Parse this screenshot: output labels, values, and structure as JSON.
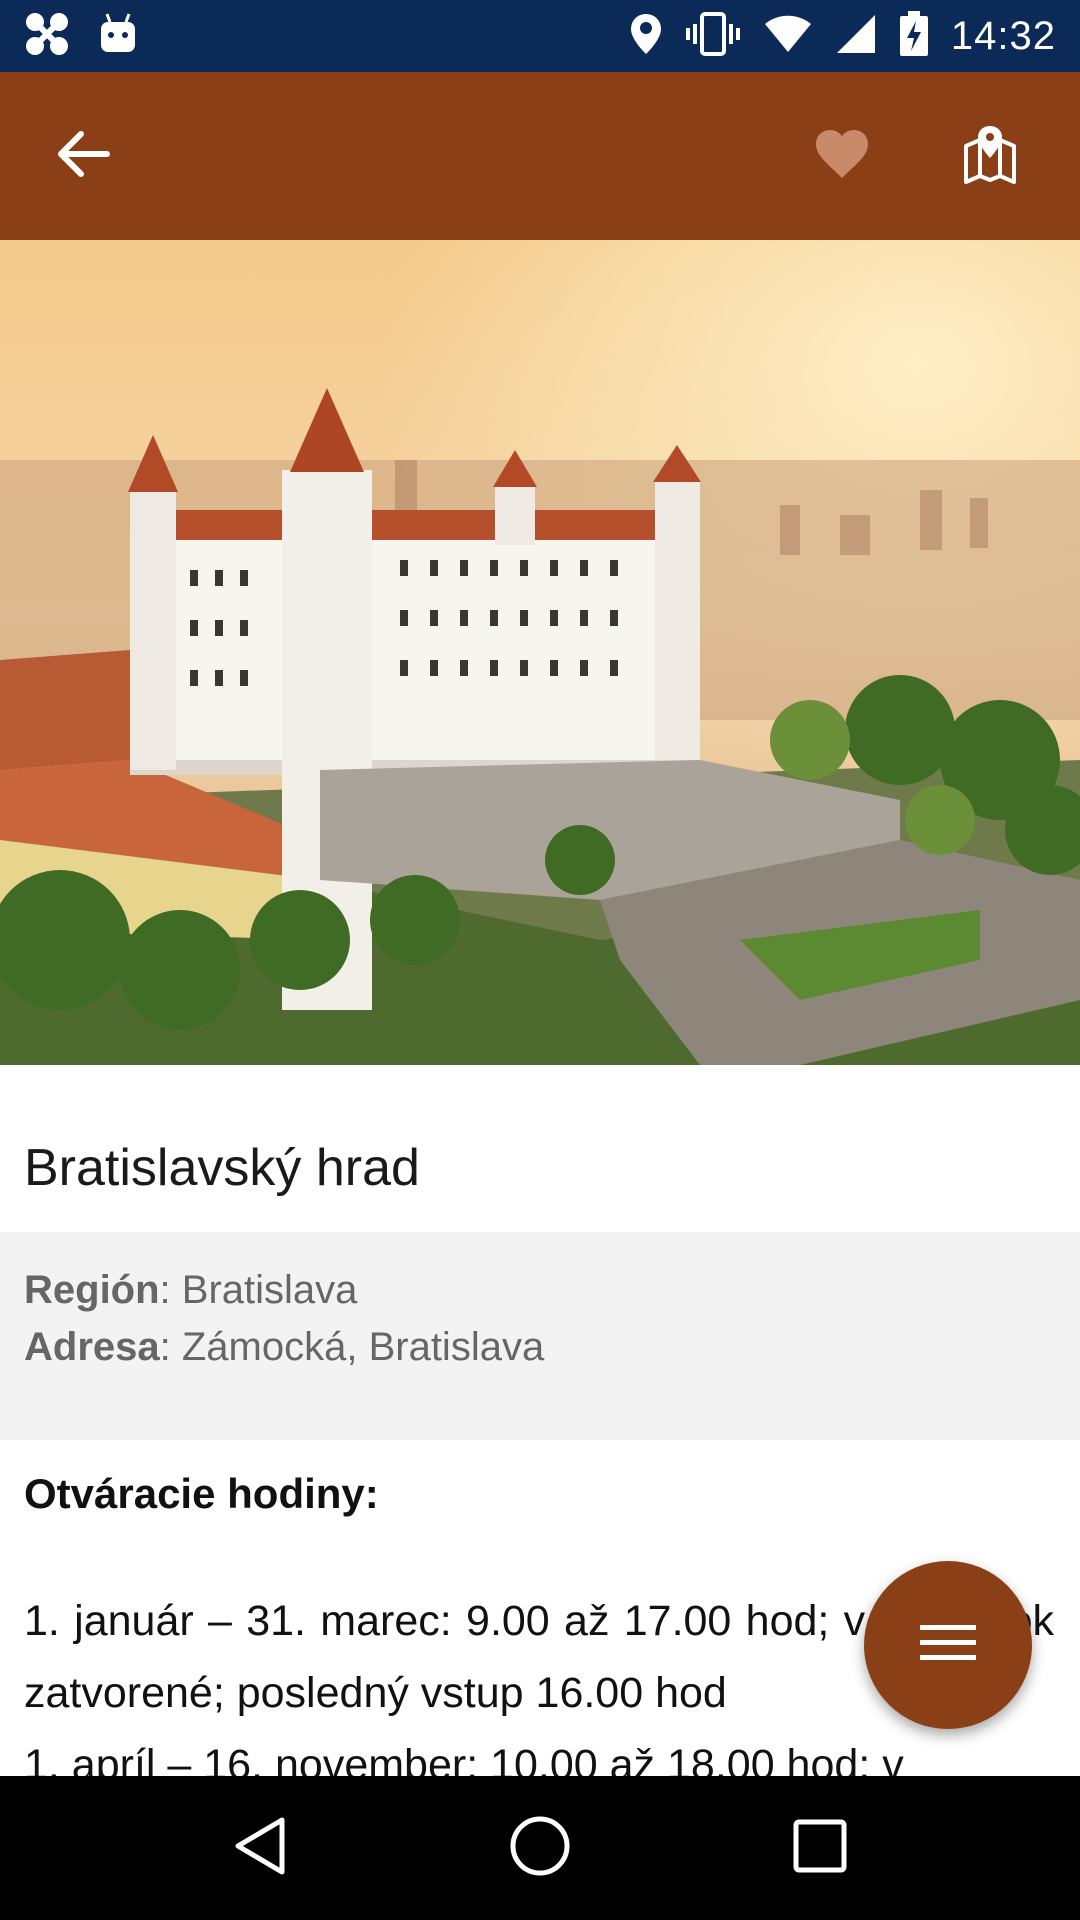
{
  "status_bar": {
    "time": "14:32",
    "left_icons": [
      "app-notification-icon",
      "android-icon"
    ],
    "right_icons": [
      "location-icon",
      "vibrate-icon",
      "wifi-icon",
      "signal-icon",
      "battery-charging-icon"
    ],
    "background": "#0b2a57"
  },
  "app_bar": {
    "background": "#8b3f16",
    "icons": [
      "back-arrow-icon",
      "heart-icon",
      "map-pin-icon"
    ]
  },
  "hero": {
    "image_subject": "Aerial view of Bratislava Castle at sunrise"
  },
  "place": {
    "title": "Bratislavský hrad",
    "region_label": "Región",
    "region_value": ": Bratislava",
    "address_label": "Adresa",
    "address_value": ": Zámocká, Bratislava"
  },
  "hours": {
    "heading": "Otváracie hodiny:",
    "line1": "1. január – 31. marec: 9.00 až 17.00 hod; v pondelok zatvorené; posledný vstup 16.00 hod",
    "line2": "1. apríl – 16. november: 10.00 až 18.00 hod; v"
  },
  "fab": {
    "icon": "menu-icon"
  },
  "nav_bar": {
    "icons": [
      "back-triangle-icon",
      "home-circle-icon",
      "recents-square-icon"
    ]
  }
}
